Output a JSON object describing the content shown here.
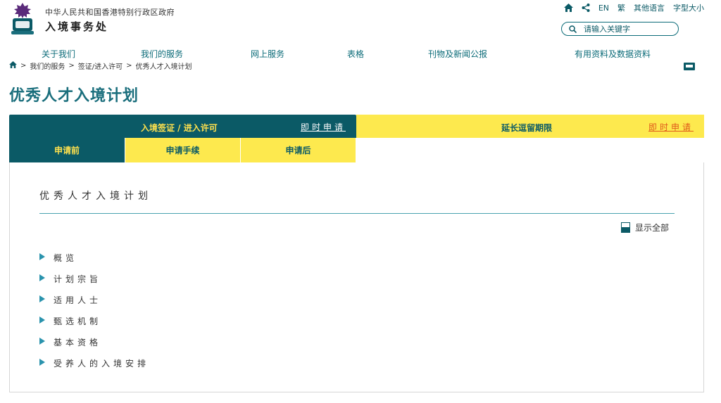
{
  "header": {
    "gov_name": "中华人民共和国香港特别行政区政府",
    "dept_name": "入境事务处",
    "utility": {
      "home_icon": "home-icon",
      "share_icon": "share-icon",
      "lang_en": "EN",
      "lang_tc": "繁",
      "other_lang": "其他语言",
      "font_size": "字型大小"
    },
    "search": {
      "placeholder": "请输入关键字",
      "icon": "search-icon"
    }
  },
  "nav": {
    "items": [
      "关于我们",
      "我们的服务",
      "网上服务",
      "表格",
      "刊物及新闻公报",
      "有用资料及数据资料"
    ]
  },
  "breadcrumb": {
    "items": [
      "我们的服务",
      "签证/进入许可",
      "优秀人才入境计划"
    ],
    "separator": ">"
  },
  "page": {
    "title": "优秀人才入境计划"
  },
  "tabs": {
    "main": [
      {
        "label": "入境签证 / 进入许可",
        "apply": "即时申请"
      },
      {
        "label": "延长逗留期限",
        "apply": "即时申请"
      }
    ],
    "sub": [
      "申请前",
      "申请手续",
      "申请后"
    ]
  },
  "content": {
    "title": "优秀人才入境计划",
    "show_all": "显示全部",
    "accordion": [
      "概览",
      "计划宗旨",
      "适用人士",
      "甄选机制",
      "基本资格",
      "受养人的入境安排"
    ]
  },
  "colors": {
    "primary_teal": "#0b5a66",
    "accent_yellow": "#fde94e",
    "title_teal": "#1a6e7c",
    "link_orange": "#e05a1b"
  }
}
